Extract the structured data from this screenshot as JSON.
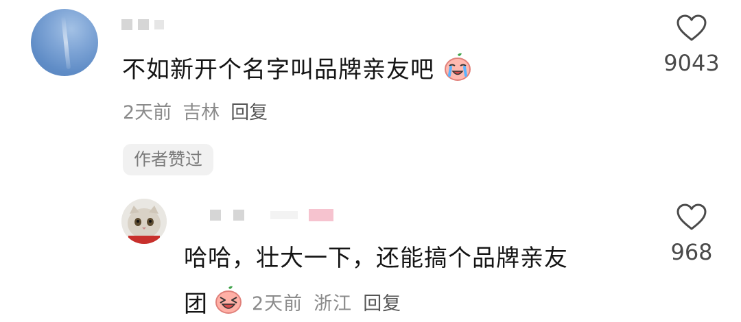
{
  "comment": {
    "username": "",
    "text": "不如新开个名字叫品牌亲友吧",
    "emoji": "crying-face-emoji",
    "time": "2天前",
    "location": "吉林",
    "reply_label": "回复",
    "author_tag": "作者赞过",
    "like_count": "9043"
  },
  "reply": {
    "username": "",
    "text_line1": "哈哈，壮大一下，还能搞个品牌亲友",
    "text_line2": "团",
    "emoji": "laughing-face-emoji",
    "time": "2天前",
    "location": "浙江",
    "reply_label": "回复",
    "like_count": "968"
  },
  "colors": {
    "text": "#151515",
    "meta": "#8a8a8a",
    "tag_bg": "#f1f1f1",
    "heart_outline": "#4a4a4a"
  }
}
